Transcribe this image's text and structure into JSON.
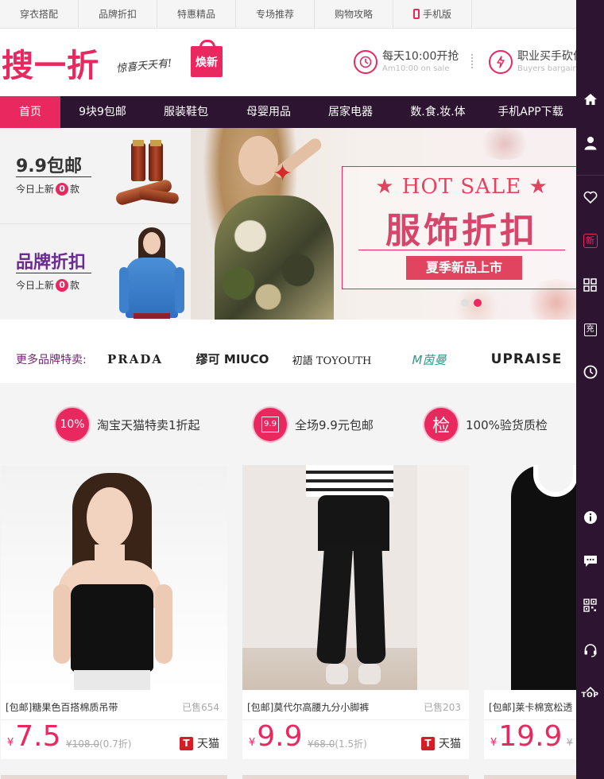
{
  "topbar": {
    "links": [
      "穿衣搭配",
      "品牌折扣",
      "特惠精品",
      "专场推荐",
      "购物攻略",
      "手机版"
    ]
  },
  "header": {
    "logo": "搜一折",
    "slogan": "惊喜天天有!",
    "bag_label": "焕新",
    "promo1_title": "每天10:00开抢",
    "promo1_sub": "Am10:00 on sale",
    "promo2_title": "职业买手砍价",
    "promo2_sub": "Buyers bargain"
  },
  "nav": {
    "items": [
      "首页",
      "9块9包邮",
      "服装鞋包",
      "母婴用品",
      "居家电器",
      "数.食.妆.体",
      "手机APP下载"
    ],
    "active_index": 0
  },
  "side_promos": [
    {
      "title": "9.9包邮",
      "sub_prefix": "今日上新",
      "count": "0",
      "sub_suffix": "款"
    },
    {
      "title": "品牌折扣",
      "sub_prefix": "今日上新",
      "count": "0",
      "sub_suffix": "款"
    }
  ],
  "banner": {
    "title": "★ HOT SALE ★",
    "headline": "服饰折扣",
    "button": "夏季新品上市",
    "active_dot": 1
  },
  "brands": {
    "label": "更多品牌特卖:",
    "logos": [
      "PRADA",
      "缪可 MIUCO",
      "初語 TOYOUTH",
      "M茵曼",
      "UPRAISE"
    ]
  },
  "features": [
    {
      "icon": "10%",
      "text": "淘宝天猫特卖1折起"
    },
    {
      "icon": "9.9",
      "text": "全场9.9元包邮"
    },
    {
      "icon": "检",
      "text": "100%验货质检"
    }
  ],
  "products": [
    {
      "name": "[包邮]糖果色百搭棉质吊带",
      "sold": "已售654",
      "currency": "¥",
      "price": "7.5",
      "original": "¥108.0",
      "discount": "(0.7折)",
      "platform": "天猫"
    },
    {
      "name": "[包邮]莫代尔高腰九分小脚裤",
      "sold": "已售203",
      "currency": "¥",
      "price": "9.9",
      "original": "¥68.0",
      "discount": "(1.5折)",
      "platform": "天猫"
    },
    {
      "name": "[包邮]莱卡棉宽松透",
      "sold": "",
      "currency": "¥",
      "price": "19.9",
      "original": "¥",
      "discount": "",
      "platform": ""
    }
  ],
  "sidebar": {
    "new_label": "新",
    "charge_label": "充",
    "top_label": "TOP"
  },
  "colors": {
    "accent": "#e8285f",
    "nav_bg": "#2d1431",
    "tmall_red": "#d11f27"
  }
}
